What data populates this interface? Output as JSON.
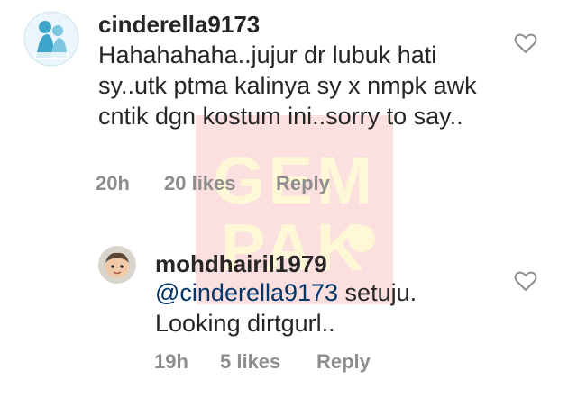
{
  "colors": {
    "text": "#262626",
    "meta": "#8e8e8e",
    "mention": "#003569",
    "watermark_bg": "#fbd5d5",
    "watermark_text": "#fff6c9"
  },
  "watermark": {
    "line1": "GEM",
    "line2": "PAK"
  },
  "comments": [
    {
      "username": "cinderella9173",
      "text": "Hahahahaha..jujur dr lubuk hati sy..utk ptma kalinya sy x nmpk awk cntik dgn kostum ini..sorry to say..",
      "time": "20h",
      "likes": "20 likes",
      "reply": "Reply",
      "avatar_icon": "profile-photo-icon",
      "heart_icon": "heart-outline-icon"
    },
    {
      "username": "mohdhairil1979",
      "mention": "@cinderella9173",
      "text": " setuju. Looking dirtgurl..",
      "time": "19h",
      "likes": "5 likes",
      "reply": "Reply",
      "avatar_icon": "profile-photo-icon",
      "heart_icon": "heart-outline-icon"
    }
  ]
}
